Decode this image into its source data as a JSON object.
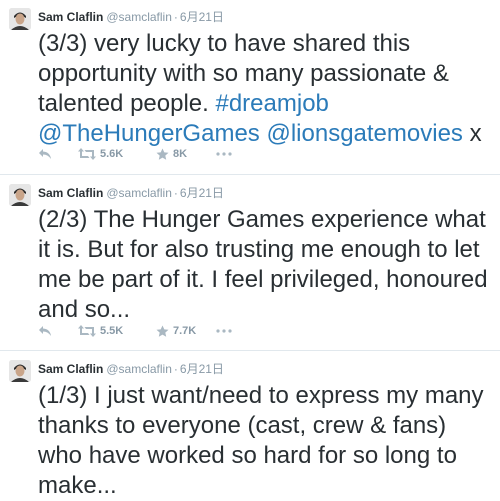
{
  "tweets": [
    {
      "name": "Sam Claflin",
      "handle": "@samclaflin",
      "separator": "·",
      "time": "6月21日",
      "text_plain": "(3/3) very lucky to have shared this opportunity with so many passionate & talented people. ",
      "link_1": "#dreamjob",
      "space_1": " ",
      "link_2": "@TheHungerGames",
      "space_2": " ",
      "link_3": "@lionsgatemovies",
      "text_tail": " x",
      "retweets": "5.6K",
      "favorites": "8K"
    },
    {
      "name": "Sam Claflin",
      "handle": "@samclaflin",
      "separator": "·",
      "time": "6月21日",
      "text": "(2/3) The Hunger Games experience what it is. But for also trusting me enough to let me be part of it. I feel privileged, honoured and so...",
      "retweets": "5.5K",
      "favorites": "7.7K"
    },
    {
      "name": "Sam Claflin",
      "handle": "@samclaflin",
      "separator": "·",
      "time": "6月21日",
      "text": "(1/3) I just want/need to express my many thanks to everyone (cast, crew & fans) who have worked so hard for so long to make..."
    }
  ],
  "icons": {
    "reply": "reply-icon",
    "retweet": "retweet-icon",
    "favorite": "star-icon",
    "more": "more-dots-icon",
    "avatar": "profile-photo"
  },
  "colors": {
    "link": "#2b7bb9",
    "meta": "#8899a6",
    "text": "#292f33",
    "divider": "#e1e8ed"
  }
}
